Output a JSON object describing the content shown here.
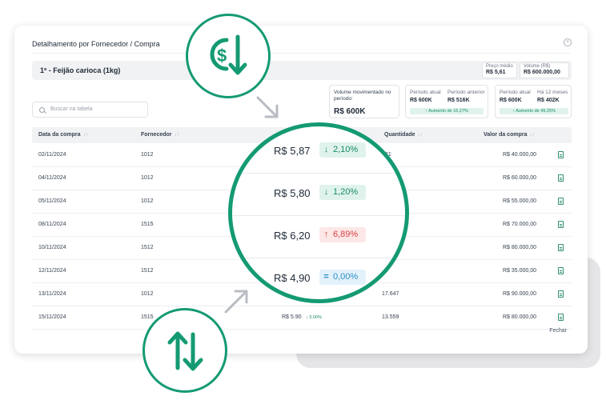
{
  "modal": {
    "title": "Detalhamento por Fornecedor / Compra",
    "close_label": "Fechar"
  },
  "product": {
    "name": "1º - Feijão carioca (1kg)",
    "preco_medio_label": "Preço médio",
    "preco_medio_value": "R$ 5,61",
    "volume_label": "Volume (R$)",
    "volume_value": "R$ 600.000,00"
  },
  "search": {
    "placeholder": "Buscar na tabela"
  },
  "stats": {
    "volume_movimentado_label": "Volume movimentado no período:",
    "volume_movimentado_value": "R$ 600K",
    "periodo_atual_label": "Período atual",
    "periodo_atual_value": "R$ 600K",
    "periodo_anterior_label": "Período anterior",
    "periodo_anterior_value": "R$ 516K",
    "aumento_periodo": "Aumento de 16,27%",
    "periodo_atual2_label": "Período atual",
    "periodo_atual2_value": "R$ 600K",
    "ha12_label": "Há 12 meses",
    "ha12_value": "R$ 402K",
    "aumento_12": "Aumento de 49,25%"
  },
  "table": {
    "headers": [
      "Data da compra",
      "Fornecedor",
      "Quantidade",
      "Valor da compra"
    ],
    "rows": [
      {
        "date": "02/11/2024",
        "supplier": "1012",
        "qty": "421",
        "value": "R$ 40.000,00"
      },
      {
        "date": "04/11/2024",
        "supplier": "1012",
        "qty": "",
        "value": "R$ 60.000,00"
      },
      {
        "date": "05/11/2024",
        "supplier": "1012",
        "qty": "",
        "value": "R$ 55.000,00"
      },
      {
        "date": "08/11/2024",
        "supplier": "1515",
        "qty": "",
        "value": "R$ 70.000,00"
      },
      {
        "date": "10/11/2024",
        "supplier": "1512",
        "qty": "",
        "value": "R$ 80.000,00"
      },
      {
        "date": "12/11/2024",
        "supplier": "1512",
        "qty": "14",
        "value": "R$ 35.000,00"
      },
      {
        "date": "13/11/2024",
        "supplier": "1012",
        "qty": "17.647",
        "value": "R$ 90.000,00"
      },
      {
        "date": "15/11/2024",
        "supplier": "1515",
        "price": "R$ 5.90",
        "delta": "3.00%",
        "qty": "13.559",
        "value": "R$ 80.000,00"
      }
    ]
  },
  "magnifier": {
    "rows": [
      {
        "price": "R$ 5,87",
        "glyph": "↓",
        "pct": "2,10%",
        "trend": "down"
      },
      {
        "price": "R$ 5,80",
        "glyph": "↓",
        "pct": "1,20%",
        "trend": "down"
      },
      {
        "price": "R$ 6,20",
        "glyph": "↑",
        "pct": "6,89%",
        "trend": "up"
      },
      {
        "price": "R$ 4,90",
        "glyph": "=",
        "pct": "0,00%",
        "trend": "flat"
      }
    ]
  },
  "icons": {
    "top_bubble": "currency-down-icon",
    "bottom_bubble": "sort-up-down-icon"
  },
  "colors": {
    "accent": "#149a73",
    "down": "#178a68",
    "up": "#d64545",
    "flat": "#2d8fc7"
  }
}
